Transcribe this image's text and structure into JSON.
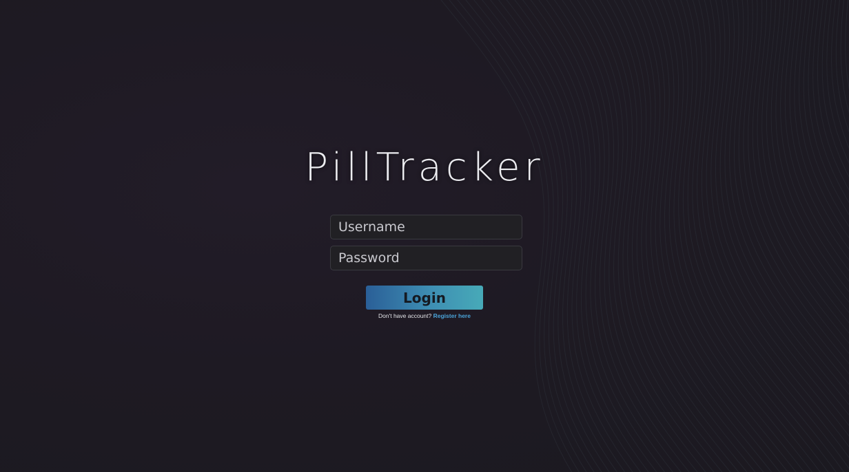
{
  "app": {
    "logo_text": "PillTracker"
  },
  "login_form": {
    "username_placeholder": "Username",
    "password_placeholder": "Password",
    "login_label": "Login",
    "register_prompt": "Don't have account?",
    "register_link": "Register here"
  },
  "colors": {
    "background": "#1e1a23",
    "field_background": "#212024",
    "button_gradient_start": "#2a5f97",
    "button_gradient_end": "#47aab8",
    "link": "#4aa3d9"
  }
}
